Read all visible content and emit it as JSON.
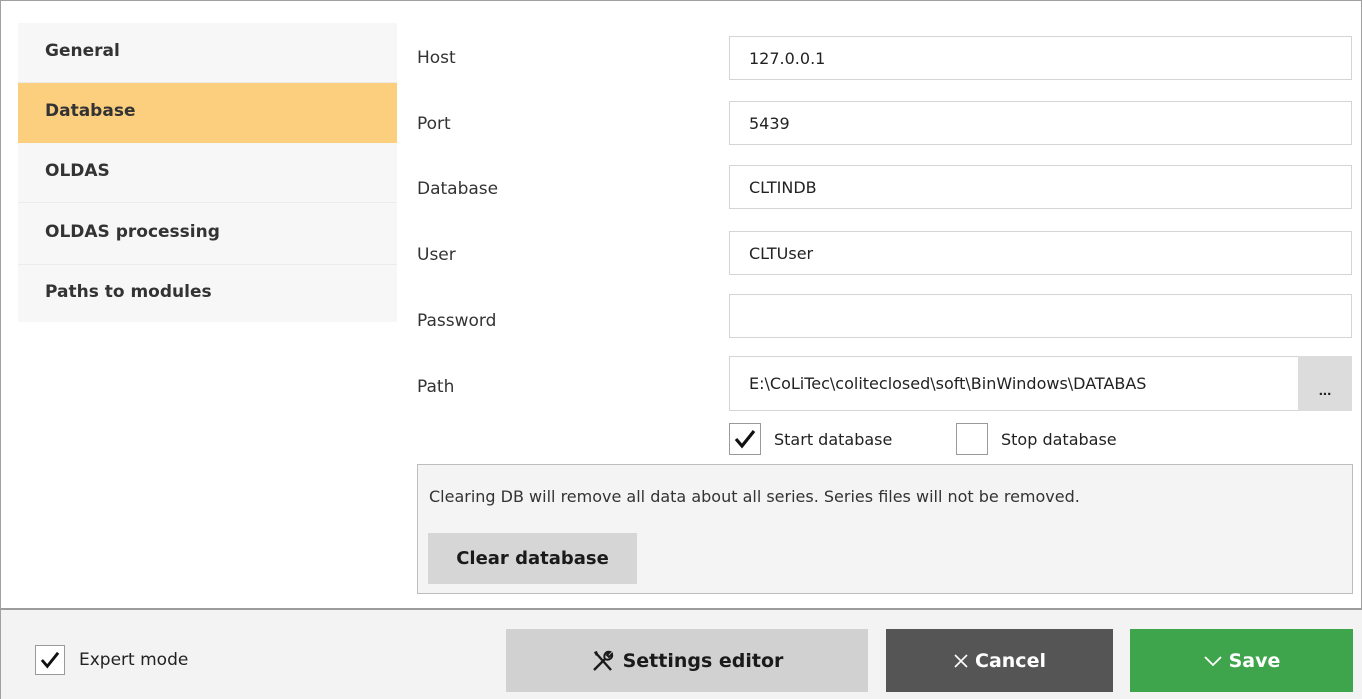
{
  "sidebar": {
    "items": [
      {
        "label": "General",
        "active": false
      },
      {
        "label": "Database",
        "active": true
      },
      {
        "label": "OLDAS",
        "active": false
      },
      {
        "label": "OLDAS processing",
        "active": false
      },
      {
        "label": "Paths to modules",
        "active": false
      }
    ]
  },
  "form": {
    "host": {
      "label": "Host",
      "value": "127.0.0.1"
    },
    "port": {
      "label": "Port",
      "value": "5439"
    },
    "database": {
      "label": "Database",
      "value": "CLTINDB"
    },
    "user": {
      "label": "User",
      "value": "CLTUser"
    },
    "password": {
      "label": "Password",
      "value": ""
    },
    "path": {
      "label": "Path",
      "value": "E:\\CoLiTec\\coliteclosed\\soft\\BinWindows\\DATABAS",
      "browse_label": "..."
    }
  },
  "options": {
    "start_database": {
      "label": "Start database",
      "checked": true
    },
    "stop_database": {
      "label": "Stop database",
      "checked": false
    }
  },
  "clear_panel": {
    "text": "Clearing DB will remove all data about all series. Series files will not be removed.",
    "button_label": "Clear database"
  },
  "footer": {
    "expert_mode": {
      "label": "Expert mode",
      "checked": true
    },
    "settings_editor_label": "Settings editor",
    "cancel_label": "Cancel",
    "save_label": "Save"
  },
  "colors": {
    "active_item": "#fccf7f",
    "save": "#3ea54c",
    "cancel": "#555555",
    "settings": "#d1d1d1"
  }
}
